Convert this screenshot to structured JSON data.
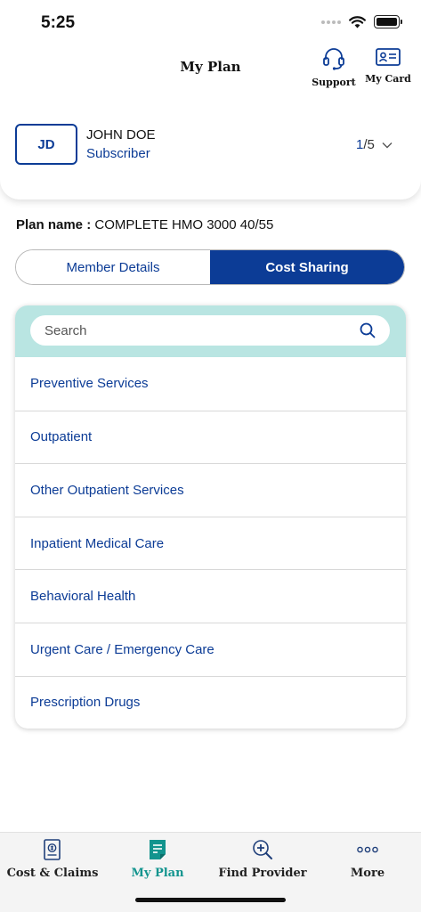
{
  "status_bar": {
    "time": "5:25"
  },
  "header": {
    "title": "My Plan",
    "support_label": "Support",
    "mycard_label": "My Card"
  },
  "member": {
    "initials": "JD",
    "name": "JOHN DOE",
    "role": "Subscriber",
    "current_index": "1",
    "total": "/5"
  },
  "plan": {
    "label": "Plan name :",
    "name": "COMPLETE HMO 3000 40/55"
  },
  "tabs": [
    {
      "label": "Member Details",
      "active": false
    },
    {
      "label": "Cost Sharing",
      "active": true
    }
  ],
  "search": {
    "placeholder": "Search"
  },
  "categories": [
    "Preventive Services",
    "Outpatient",
    "Other Outpatient Services",
    "Inpatient Medical Care",
    "Behavioral Health",
    "Urgent Care / Emergency Care",
    "Prescription Drugs"
  ],
  "bottom_nav": [
    {
      "label": "Cost & Claims",
      "icon": "claims-icon",
      "active": false
    },
    {
      "label": "My Plan",
      "icon": "plan-document-icon",
      "active": true
    },
    {
      "label": "Find Provider",
      "icon": "provider-search-icon",
      "active": false
    },
    {
      "label": "More",
      "icon": "more-dots-icon",
      "active": false
    }
  ],
  "colors": {
    "brand_blue": "#0c3c96",
    "teal_active": "#12948e",
    "search_band": "#b9e5e2"
  }
}
